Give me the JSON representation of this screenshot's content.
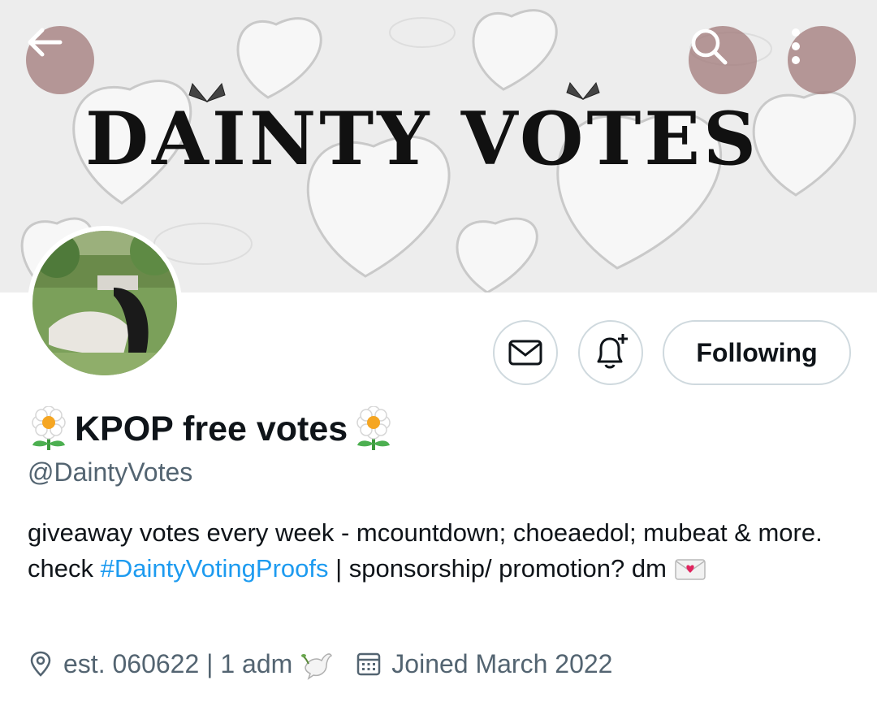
{
  "header": {
    "banner_title": "DAINTY VOTES",
    "back_icon": "arrow-left-icon",
    "search_icon": "search-icon",
    "more_icon": "more-vertical-icon"
  },
  "actions": {
    "message_icon": "envelope-icon",
    "notify_icon": "bell-plus-icon",
    "following_label": "Following"
  },
  "profile": {
    "display_name": "KPOP free votes",
    "name_emoji": "daisy-emoji",
    "handle": "@DaintyVotes",
    "bio": {
      "part1": "giveaway votes every week - mcountdown; choeaedol; mubeat & more. check ",
      "hashtag": "#DaintyVotingProofs",
      "part2": " | sponsorship/ promotion? dm ",
      "emoji": "love-letter-emoji"
    },
    "location": "est. 060622 | 1 adm",
    "location_emoji": "dove-emoji",
    "joined": "Joined March 2022"
  },
  "colors": {
    "accent": "#1d9bf0",
    "secondary_text": "#536471",
    "border": "#cfd9de",
    "overlay_button": "#a07878"
  }
}
